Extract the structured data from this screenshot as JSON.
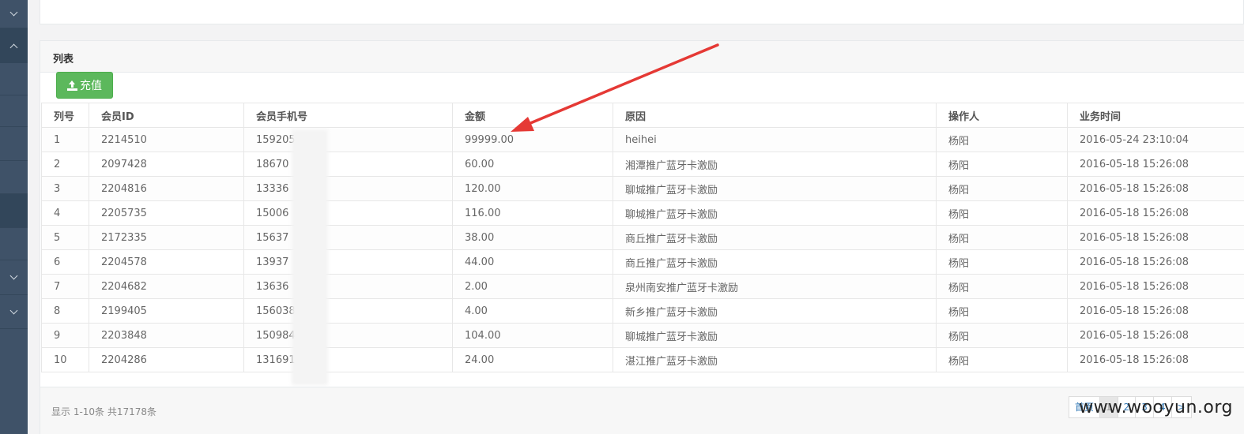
{
  "panel": {
    "title": "列表",
    "recharge_label": "充值"
  },
  "table": {
    "headers": [
      "列号",
      "会员ID",
      "会员手机号",
      "金额",
      "原因",
      "操作人",
      "业务时间"
    ],
    "rows": [
      [
        "1",
        "2214510",
        "159205",
        "99999.00",
        "heihei",
        "杨阳",
        "2016-05-24 23:10:04"
      ],
      [
        "2",
        "2097428",
        "18670",
        "60.00",
        "湘潭推广蓝牙卡激励",
        "杨阳",
        "2016-05-18 15:26:08"
      ],
      [
        "3",
        "2204816",
        "13336",
        "120.00",
        "聊城推广蓝牙卡激励",
        "杨阳",
        "2016-05-18 15:26:08"
      ],
      [
        "4",
        "2205735",
        "15006",
        "116.00",
        "聊城推广蓝牙卡激励",
        "杨阳",
        "2016-05-18 15:26:08"
      ],
      [
        "5",
        "2172335",
        "15637",
        "38.00",
        "商丘推广蓝牙卡激励",
        "杨阳",
        "2016-05-18 15:26:08"
      ],
      [
        "6",
        "2204578",
        "13937",
        "44.00",
        "商丘推广蓝牙卡激励",
        "杨阳",
        "2016-05-18 15:26:08"
      ],
      [
        "7",
        "2204682",
        "13636",
        "2.00",
        "泉州南安推广蓝牙卡激励",
        "杨阳",
        "2016-05-18 15:26:08"
      ],
      [
        "8",
        "2199405",
        "156038",
        "4.00",
        "新乡推广蓝牙卡激励",
        "杨阳",
        "2016-05-18 15:26:08"
      ],
      [
        "9",
        "2203848",
        "150984",
        "104.00",
        "聊城推广蓝牙卡激励",
        "杨阳",
        "2016-05-18 15:26:08"
      ],
      [
        "10",
        "2204286",
        "1316912",
        "24.00",
        "湛江推广蓝牙卡激励",
        "杨阳",
        "2016-05-18 15:26:08"
      ]
    ]
  },
  "footer": {
    "summary": "显示 1-10条 共17178条",
    "pager": [
      "首页",
      "1",
      "2",
      "3",
      "4",
      ">"
    ]
  },
  "watermark": "www.wooyun.org",
  "colors": {
    "sidebar": "#3f5268",
    "button": "#5cb85c",
    "annotation_arrow": "#e53935"
  }
}
